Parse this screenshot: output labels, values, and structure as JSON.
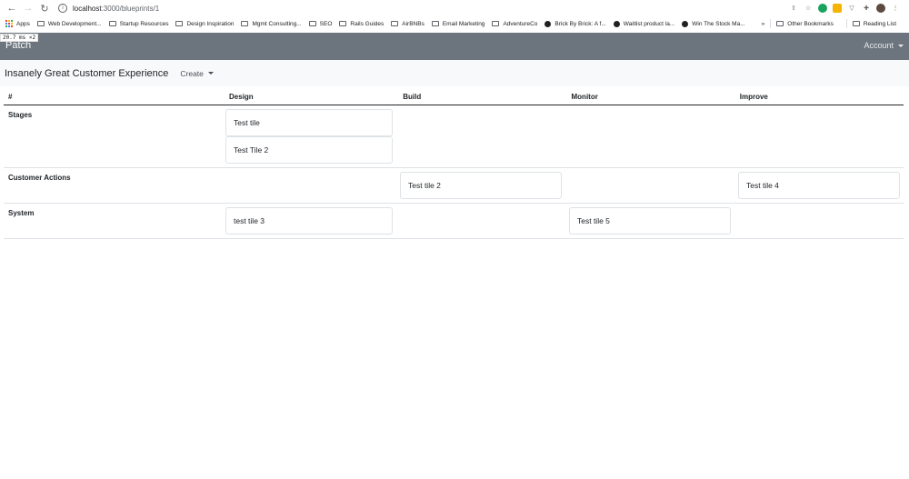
{
  "browser": {
    "url_host": "localhost",
    "url_path": ":3000/blueprints/1",
    "bookmarks": [
      {
        "label": "Apps",
        "icon": "apps-grid-icon"
      },
      {
        "label": "Web Development...",
        "icon": "folder-icon"
      },
      {
        "label": "Startup Resources",
        "icon": "folder-icon"
      },
      {
        "label": "Design Inspiration",
        "icon": "folder-icon"
      },
      {
        "label": "Mgmt Consulting...",
        "icon": "folder-icon"
      },
      {
        "label": "SEO",
        "icon": "folder-icon"
      },
      {
        "label": "Rails Guides",
        "icon": "folder-icon"
      },
      {
        "label": "AirBNBs",
        "icon": "folder-icon"
      },
      {
        "label": "Email Marketing",
        "icon": "folder-icon"
      },
      {
        "label": "AdventureCo",
        "icon": "folder-icon"
      },
      {
        "label": "Brick By Brick: A f...",
        "icon": "globe-icon"
      },
      {
        "label": "Waitlist product la...",
        "icon": "globe-icon"
      },
      {
        "label": "Win The Stock Ma...",
        "icon": "globe-icon"
      }
    ],
    "overflow_label": "»",
    "other_bookmarks": "Other Bookmarks",
    "reading_list": "Reading List",
    "perf_badge": "20.7 ms ×2"
  },
  "navbar": {
    "brand": "Patch",
    "account": "Account",
    "bg_color": "#6c757d"
  },
  "page": {
    "title": "Insanely Great Customer Experience",
    "create_label": "Create"
  },
  "table": {
    "headers": [
      "#",
      "Design",
      "Build",
      "Monitor",
      "Improve"
    ],
    "rows": [
      {
        "label": "Stages",
        "design": [
          "Test tile",
          "Test Tile 2"
        ],
        "build": [],
        "monitor": [],
        "improve": []
      },
      {
        "label": "Customer Actions",
        "design": [],
        "build": [
          "Test tile 2"
        ],
        "monitor": [],
        "improve": [
          "Test tile 4"
        ]
      },
      {
        "label": "System",
        "design": [
          "test tile 3"
        ],
        "build": [],
        "monitor": [
          "Test tile 5"
        ],
        "improve": []
      }
    ]
  }
}
